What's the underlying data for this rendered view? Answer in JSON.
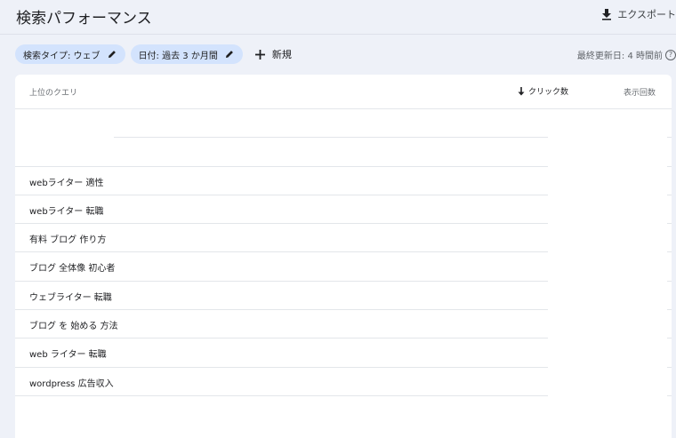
{
  "header": {
    "title": "検索パフォーマンス",
    "export_label": "エクスポート"
  },
  "filters": {
    "chips": [
      {
        "label": "検索タイプ: ウェブ"
      },
      {
        "label": "日付: 過去 3 か月間"
      }
    ],
    "new_label": "新規",
    "last_updated": "最終更新日: 4 時間前"
  },
  "table": {
    "columns": {
      "query": "上位のクエリ",
      "clicks": "クリック数",
      "impressions": "表示回数"
    },
    "rows": [
      {
        "query": ""
      },
      {
        "query": ""
      },
      {
        "query": "webライター 適性"
      },
      {
        "query": "webライター 転職"
      },
      {
        "query": "有料 ブログ 作り方"
      },
      {
        "query": "ブログ 全体像 初心者"
      },
      {
        "query": "ウェブライター 転職"
      },
      {
        "query": "ブログ を 始める 方法"
      },
      {
        "query": "web ライター 転職"
      },
      {
        "query": "wordpress 広告収入"
      }
    ]
  },
  "colors": {
    "page_bg": "#eef1f8",
    "chip_bg": "#d3e3fd",
    "card_bg": "#ffffff"
  }
}
